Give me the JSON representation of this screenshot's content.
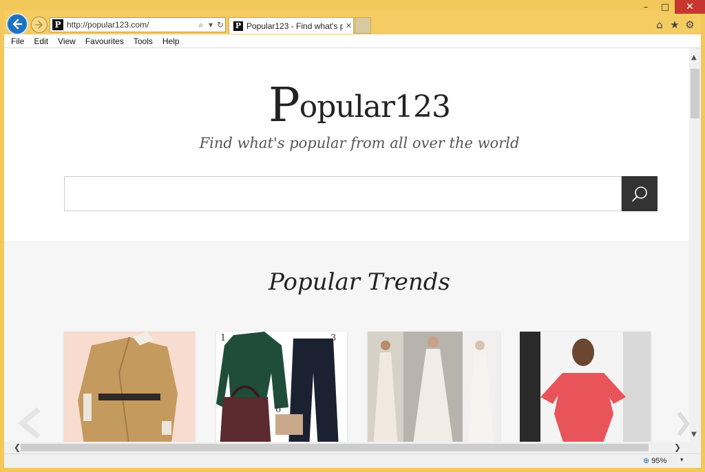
{
  "window": {
    "minimize_glyph": "–",
    "maximize_glyph": "□",
    "close_glyph": "✕"
  },
  "browser": {
    "address": "http://popular123.com/",
    "favicon_letter": "P",
    "tab_title": "Popular123 - Find what's p...",
    "tab_close_glyph": "✕",
    "icons": [
      "back-icon",
      "forward-icon",
      "search-icon",
      "dropdown-icon",
      "refresh-icon",
      "home-icon",
      "star-icon",
      "gear-icon"
    ],
    "home_glyph": "⌂",
    "star_glyph": "★",
    "gear_glyph": "⚙",
    "search_glyph": "⌕",
    "dropdown_glyph": "▾",
    "refresh_glyph": "↻"
  },
  "menu": [
    {
      "label": "File"
    },
    {
      "label": "Edit"
    },
    {
      "label": "View"
    },
    {
      "label": "Favourites"
    },
    {
      "label": "Tools"
    },
    {
      "label": "Help"
    }
  ],
  "page": {
    "logo_first": "P",
    "logo_rest": "opular123",
    "tagline": "Find what's popular from all over the world",
    "search": {
      "placeholder": ""
    },
    "trends_title": "Popular Trends",
    "card2_numbers": [
      "1",
      "3",
      "6"
    ]
  },
  "status": {
    "zoom": "95%",
    "zoom_glyph": "⊕",
    "dropdown_glyph": "▾"
  },
  "scroll": {
    "up_glyph": "▲",
    "down_glyph": "▼",
    "left_glyph": "❮",
    "right_glyph": "❯"
  },
  "colors": {
    "frame": "#f2c85a",
    "back_button": "#1e73be",
    "search_button": "#333333",
    "close_button": "#c7372f"
  }
}
